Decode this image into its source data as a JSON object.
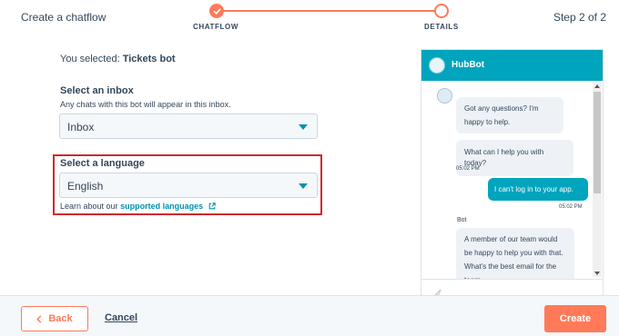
{
  "header": {
    "app_title": "Create a chatflow",
    "steps": [
      {
        "label": "CHATFLOW",
        "state": "complete"
      },
      {
        "label": "DETAILS",
        "state": "current"
      }
    ],
    "step_label": "Step 2 of 2"
  },
  "form": {
    "selected_prefix": "You selected:",
    "selected_value": "Tickets bot",
    "inbox": {
      "title": "Select an inbox",
      "help": "Any chats with this bot will appear in this inbox.",
      "value": "Inbox"
    },
    "language": {
      "title": "Select a language",
      "value": "English",
      "learn_prefix": "Learn about our",
      "learn_link": "supported languages"
    }
  },
  "chat": {
    "title": "HubBot",
    "messages": [
      {
        "from": "bot",
        "text": "Got any questions? I'm happy to help."
      },
      {
        "from": "bot",
        "text": "What can I help you with today?",
        "time": "05:02 PM"
      },
      {
        "from": "user",
        "text": "I can't log in to your app.",
        "time": "05:02 PM"
      },
      {
        "sender": "Bot",
        "from": "bot",
        "text": "A member of our team would be happy to help you with that. What's the best email for the team"
      }
    ]
  },
  "footer": {
    "back_label": "Back",
    "cancel_label": "Cancel",
    "create_label": "Create"
  },
  "colors": {
    "accent": "#ff7a59",
    "chat_header": "#00a4bd",
    "link": "#0091ae",
    "highlight": "#d0282e",
    "text": "#33475b"
  }
}
